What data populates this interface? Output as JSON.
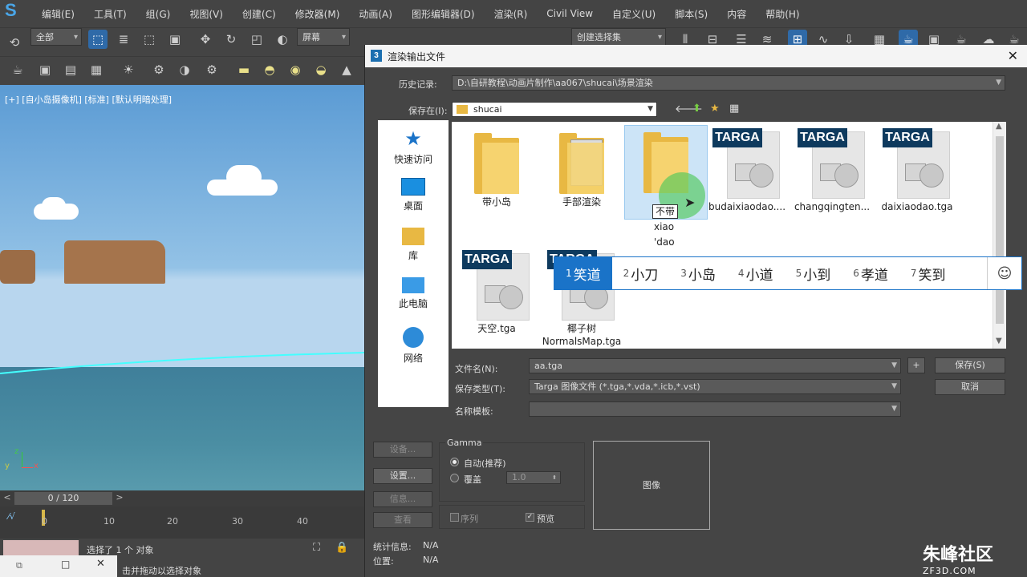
{
  "app": {
    "menu": [
      "编辑(E)",
      "工具(T)",
      "组(G)",
      "视图(V)",
      "创建(C)",
      "修改器(M)",
      "动画(A)",
      "图形编辑器(D)",
      "渲染(R)",
      "Civil View",
      "自定义(U)",
      "脚本(S)",
      "内容",
      "帮助(H)"
    ],
    "toolbar": {
      "filter_dropdown": "全部",
      "coord_dropdown": "屏幕",
      "selection_set_dropdown": "创建选择集"
    },
    "viewport": {
      "label": "[+] [自小岛摄像机] [标准] [默认明暗处理]",
      "axis_z": "z",
      "axis_y": "y",
      "axis_x": "x"
    },
    "timeline": {
      "frame_counter": "0 / 120",
      "prev": "<",
      "next": ">",
      "ticks": [
        "0",
        "10",
        "20",
        "30",
        "40"
      ]
    },
    "status": {
      "selected": "选择了 1 个 对象",
      "hint": "击并拖动以选择对象"
    }
  },
  "dialog": {
    "title": "渲染输出文件",
    "close": "✕",
    "history_label": "历史记录:",
    "history_value": "D:\\自研教程\\动画片制作\\aa067\\shucai\\场景渲染",
    "save_in_label": "保存在(I):",
    "save_in_value": "shucai",
    "places": [
      "快速访问",
      "桌面",
      "库",
      "此电脑",
      "网络"
    ],
    "files": [
      {
        "name": "带小岛",
        "kind": "folder"
      },
      {
        "name": "手部渲染",
        "kind": "folder-doc"
      },
      {
        "name": "不带",
        "kind": "folder-selected",
        "rename_lines": [
          "不带",
          "xiao",
          "'dao"
        ]
      },
      {
        "name": "budaixiaodao....",
        "kind": "tga"
      },
      {
        "name": "changqingten...",
        "kind": "tga"
      },
      {
        "name": "daixiaodao.tga",
        "kind": "tga"
      },
      {
        "name": "天空.tga",
        "kind": "tga"
      },
      {
        "name": "椰子树 NormalsMap.tga",
        "kind": "tga"
      }
    ],
    "badge_text": "TARGA",
    "ime_candidates": [
      {
        "n": "1",
        "t": "笑道"
      },
      {
        "n": "2",
        "t": "小刀"
      },
      {
        "n": "3",
        "t": "小岛"
      },
      {
        "n": "4",
        "t": "小道"
      },
      {
        "n": "5",
        "t": "小到"
      },
      {
        "n": "6",
        "t": "孝道"
      },
      {
        "n": "7",
        "t": "笑到"
      }
    ],
    "ime_emoji": "☺",
    "filename_label": "文件名(N):",
    "filename_value": "aa.tga",
    "filetype_label": "保存类型(T):",
    "filetype_value": "Targa 图像文件 (*.tga,*.vda,*.icb,*.vst)",
    "template_label": "名称模板:",
    "plus_button": "+",
    "save_button": "保存(S)",
    "cancel_button": "取消",
    "setup_button_disabled": "设备...",
    "setup_button": "设置...",
    "info_button": "信息...",
    "view_button": "查看",
    "gamma_title": "Gamma",
    "gamma_auto": "自动(推荐)",
    "gamma_override": "覆盖",
    "gamma_value": "1.0",
    "sequence_label": "序列",
    "preview_label": "预览",
    "image_box_label": "图像",
    "stats_label": "统计信息:",
    "stats_value": "N/A",
    "location_label": "位置:",
    "location_value": "N/A"
  },
  "watermark": {
    "brand": "朱峰社区",
    "url": "ZF3D.COM"
  },
  "colors": {
    "accent": "#1a73c8",
    "dialog_bg": "#454545",
    "folder": "#e8b843",
    "targa_badge": "#0e3a5e"
  }
}
